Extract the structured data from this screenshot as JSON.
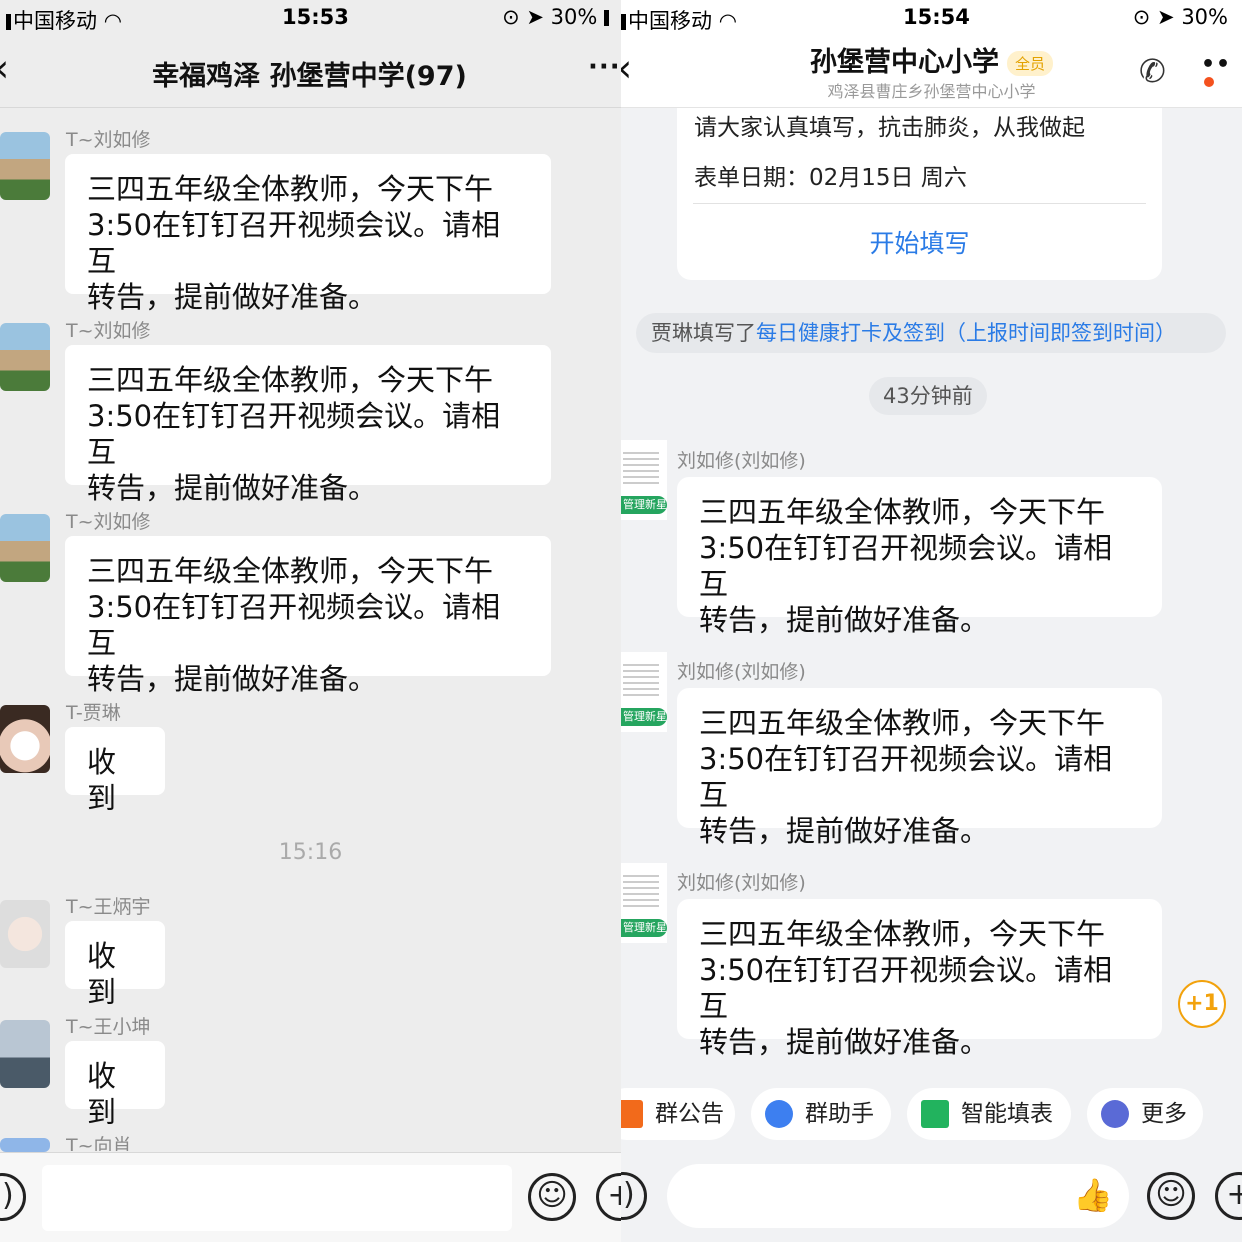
{
  "left": {
    "status": {
      "carrier": "中国移动",
      "time": "15:53",
      "battery": "30%"
    },
    "nav": {
      "title": "幸福鸡泽 孙堡营中学(97)",
      "back": "‹",
      "more": "···"
    },
    "messages": [
      {
        "sender": "T~刘如修",
        "text_lines": [
          "三四五年级全体教师，今天下午",
          "3:50在钉钉召开视频会议。请相互",
          "转告，提前做好准备。"
        ]
      },
      {
        "sender": "T~刘如修",
        "text_lines": [
          "三四五年级全体教师，今天下午",
          "3:50在钉钉召开视频会议。请相互",
          "转告，提前做好准备。"
        ]
      },
      {
        "sender": "T~刘如修",
        "text_lines": [
          "三四五年级全体教师，今天下午",
          "3:50在钉钉召开视频会议。请相互",
          "转告，提前做好准备。"
        ]
      },
      {
        "sender": "T-贾琳",
        "text": "收到"
      },
      {
        "sender": "T~王炳宇",
        "text": "收到"
      },
      {
        "sender": "T~王小坤",
        "text": "收到"
      },
      {
        "sender": "T~向肖"
      }
    ],
    "time_divider": "15:16"
  },
  "right": {
    "status": {
      "carrier": "中国移动",
      "time": "15:54",
      "battery": "30%"
    },
    "nav": {
      "title": "孙堡营中心小学",
      "badge": "全员",
      "subtitle": "鸡泽县曹庄乡孙堡营中心小学",
      "back": "‹",
      "more": "••"
    },
    "form_card": {
      "line1": "请大家认真填写，抗击肺炎，从我做起",
      "line2": "表单日期：02月15日 周六",
      "action": "开始填写"
    },
    "notice": {
      "prefix": "贾琳填写了",
      "link": "每日健康打卡及签到（上报时间即签到时间）"
    },
    "time_divider": "43分钟前",
    "avatar_label": "管理新星",
    "messages": [
      {
        "sender": "刘如修(刘如修)",
        "text_lines": [
          "三四五年级全体教师，今天下午",
          "3:50在钉钉召开视频会议。请相互",
          "转告，提前做好准备。"
        ]
      },
      {
        "sender": "刘如修(刘如修)",
        "text_lines": [
          "三四五年级全体教师，今天下午",
          "3:50在钉钉召开视频会议。请相互",
          "转告，提前做好准备。"
        ]
      },
      {
        "sender": "刘如修(刘如修)",
        "text_lines": [
          "三四五年级全体教师，今天下午",
          "3:50在钉钉召开视频会议。请相互",
          "转告，提前做好准备。"
        ]
      }
    ],
    "plus_one": "+1",
    "toolbar": [
      {
        "label": "群公告",
        "icon": "speaker-icon",
        "color": "#f26a1b"
      },
      {
        "label": "群助手",
        "icon": "assistant-icon",
        "color": "#3d7ff0"
      },
      {
        "label": "智能填表",
        "icon": "form-icon",
        "color": "#22b35e"
      },
      {
        "label": "更多",
        "icon": "more-icon",
        "color": "#5a6ad6"
      }
    ]
  },
  "colors": {
    "link": "#2a7be6",
    "badge": "#e3a200",
    "plus_one": "#f2a20c"
  }
}
